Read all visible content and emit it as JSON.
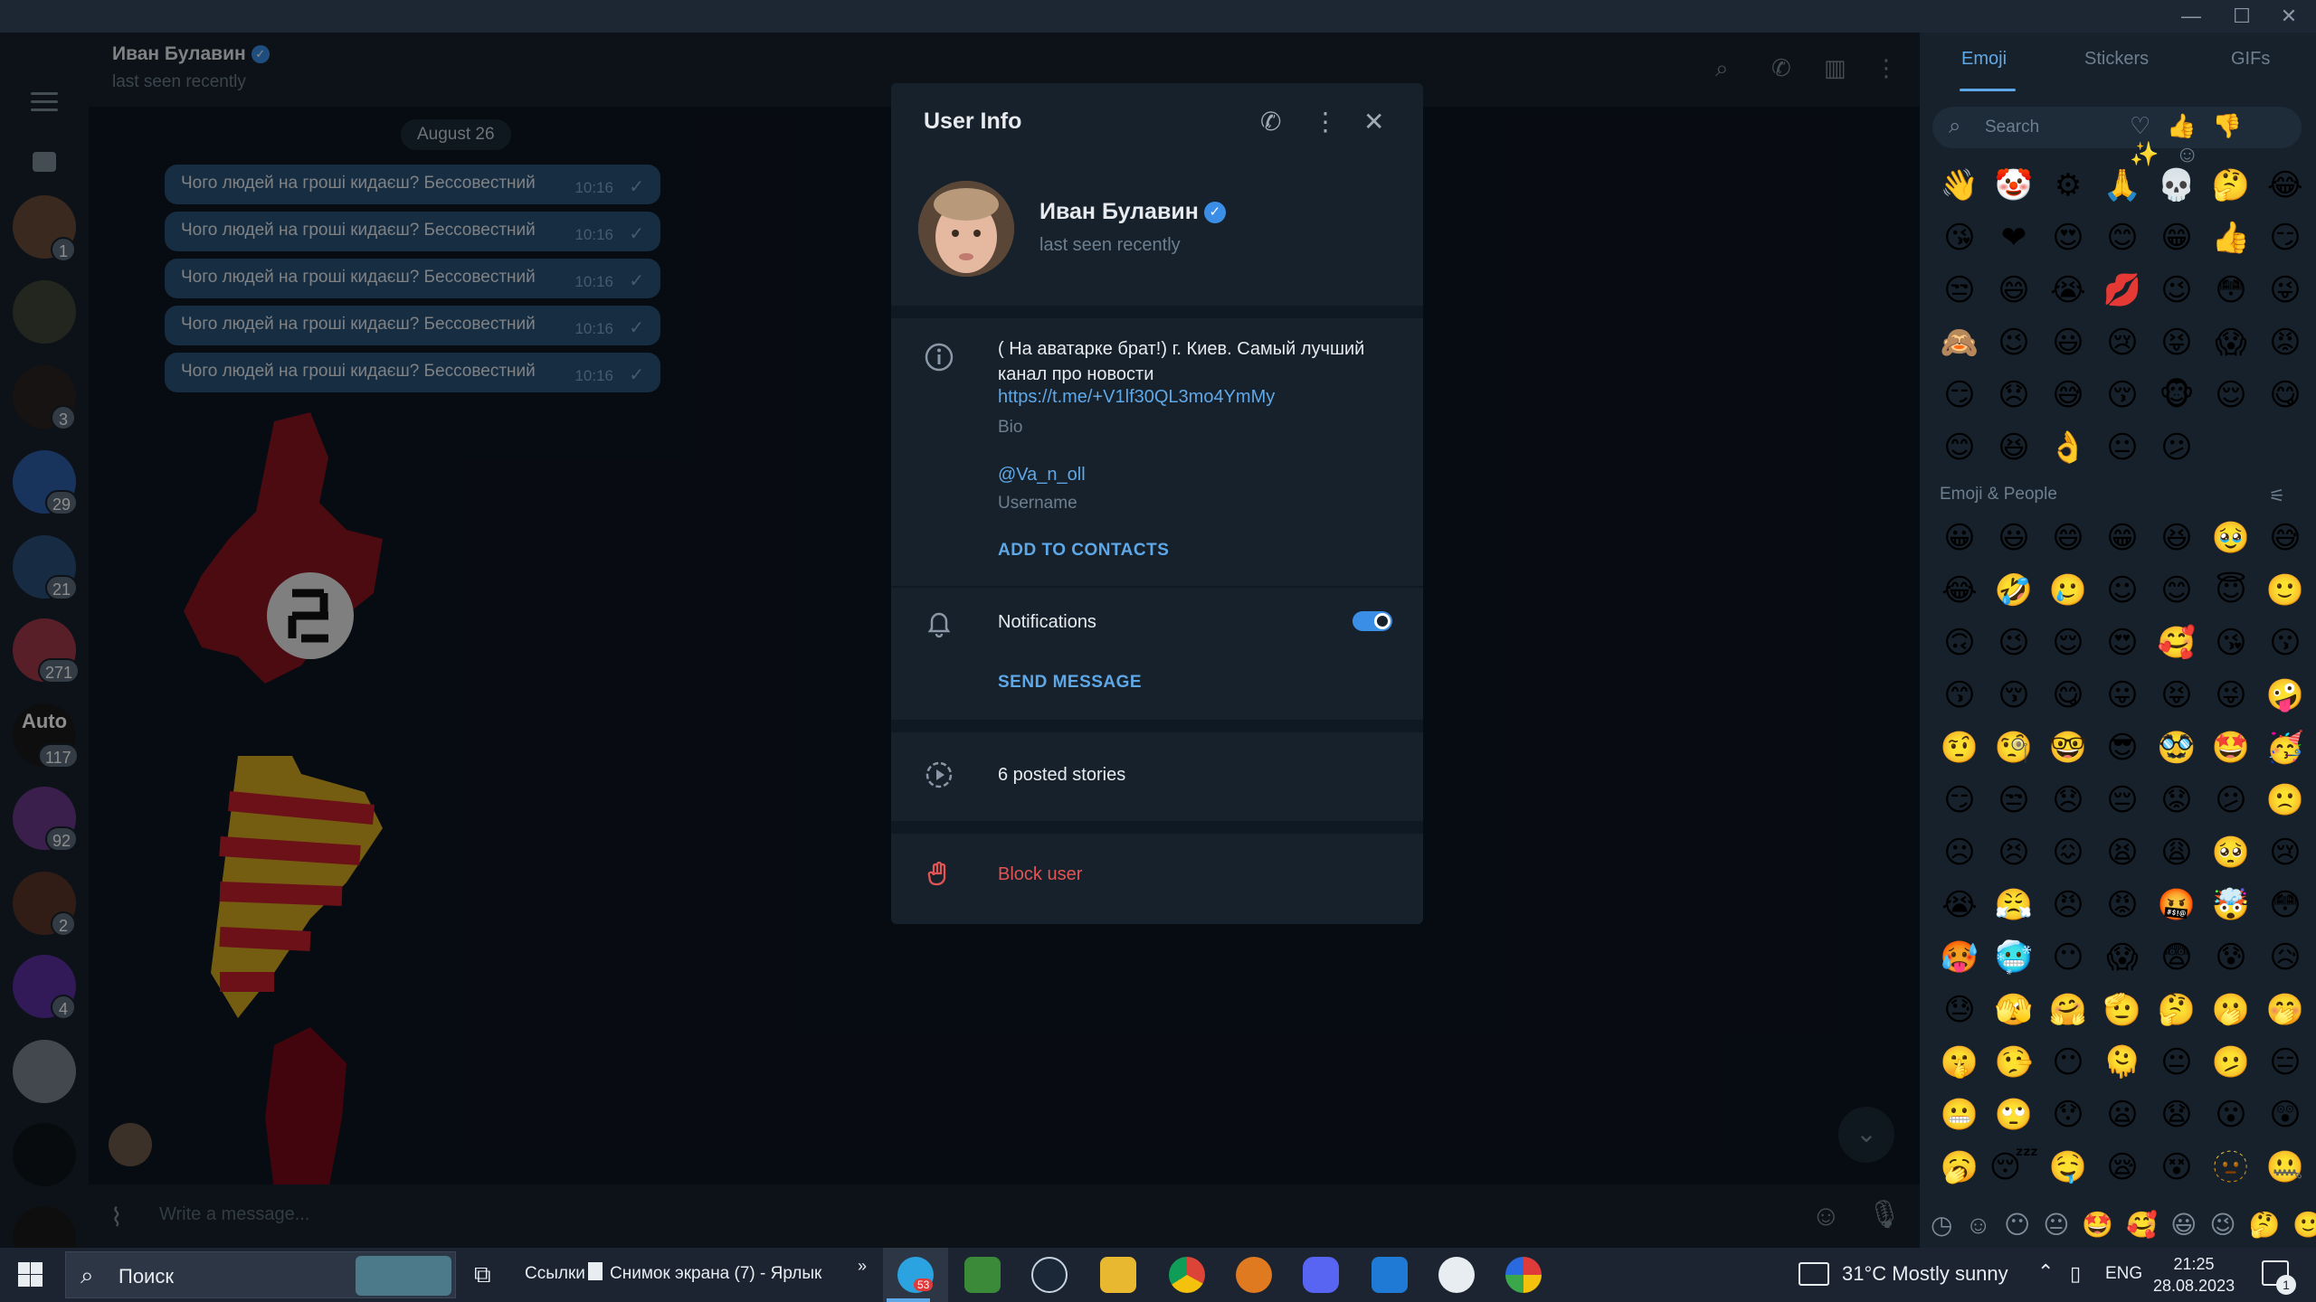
{
  "window": {
    "minimize": "—",
    "maximize": "☐",
    "close": "✕"
  },
  "sidebar": {
    "badges": [
      "1",
      "3",
      "29",
      "21",
      "271",
      "117",
      "92",
      "2",
      "4"
    ],
    "autohub_label": "Auto"
  },
  "chat": {
    "title": "Иван Булавин",
    "status": "last seen recently",
    "date": "August 26",
    "messages": [
      {
        "text": "Чого людей на гроші кидаєш? Бессовестний",
        "time": "10:16"
      },
      {
        "text": "Чого людей на гроші кидаєш? Бессовестний",
        "time": "10:16"
      },
      {
        "text": "Чого людей на гроші кидаєш? Бессовестний",
        "time": "10:16"
      },
      {
        "text": "Чого людей на гроші кидаєш? Бессовестний",
        "time": "10:16"
      },
      {
        "text": "Чого людей на гроші кидаєш? Бессовестний",
        "time": "10:16"
      }
    ],
    "input_placeholder": "Write a message..."
  },
  "user_info": {
    "title": "User Info",
    "name": "Иван Булавин",
    "status": "last seen recently",
    "bio": "( На аватарке брат!) г. Киев. Самый лучший канал про новости",
    "bio_link": "https://t.me/+V1lf30QL3mo4YmMy",
    "bio_caption": "Bio",
    "username": "@Va_n_oll",
    "username_caption": "Username",
    "add_to_contacts": "ADD TO CONTACTS",
    "notifications_label": "Notifications",
    "notifications_on": true,
    "send_message": "SEND MESSAGE",
    "stories": "6 posted stories",
    "block": "Block user"
  },
  "emoji_panel": {
    "tabs": [
      "Emoji",
      "Stickers",
      "GIFs"
    ],
    "active_tab": "Emoji",
    "search_placeholder": "Search",
    "section_title": "Emoji & People",
    "recent": [
      "👋",
      "🤡",
      "⚙",
      "🙏",
      "💀",
      "🤔",
      "😂",
      "😘",
      "❤",
      "😍",
      "😊",
      "😁",
      "👍",
      "😏",
      "😒",
      "😄",
      "😭",
      "💋",
      "😉",
      "😳",
      "😜",
      "🙈",
      "😉",
      "😃",
      "😢",
      "😝",
      "😱",
      "😡",
      "😏",
      "😞",
      "😅",
      "😚",
      "🐵",
      "😌",
      "😋",
      "😊",
      "😆",
      "👌",
      "😐",
      "😕"
    ],
    "people": [
      "😀",
      "😃",
      "😄",
      "😁",
      "😆",
      "🥹",
      "😅",
      "😂",
      "🤣",
      "🥲",
      "☺",
      "😊",
      "😇",
      "🙂",
      "🙃",
      "😉",
      "😌",
      "😍",
      "🥰",
      "😘",
      "😗",
      "😙",
      "😚",
      "😋",
      "😛",
      "😝",
      "😜",
      "🤪",
      "🤨",
      "🧐",
      "🤓",
      "😎",
      "🥸",
      "🤩",
      "🥳",
      "😏",
      "😒",
      "😞",
      "😔",
      "😟",
      "😕",
      "🙁",
      "☹",
      "😣",
      "😖",
      "😫",
      "😩",
      "🥺",
      "😢",
      "😭",
      "😤",
      "😠",
      "😡",
      "🤬",
      "🤯",
      "😳",
      "🥵",
      "🥶",
      "😶",
      "😱",
      "😨",
      "😰",
      "😥",
      "😓",
      "🫣",
      "🤗",
      "🫡",
      "🤔",
      "🫢",
      "🤭",
      "🤫",
      "🤥",
      "😶",
      "🫠",
      "😐",
      "🫤",
      "😑",
      "😬",
      "🙄",
      "😯",
      "😦",
      "😧",
      "😮",
      "😲",
      "🥱",
      "😴",
      "🤤",
      "😪",
      "😵",
      "🫥",
      "🤐"
    ],
    "colors": {
      "accent": "#5fa8e8"
    }
  },
  "taskbar": {
    "search": "Поиск",
    "links": "Ссылки",
    "pinned_file": "Снимок экрана (7) - Ярлык",
    "telegram_badge": "53",
    "weather": "31°C  Mostly sunny",
    "lang": "ENG",
    "time": "21:25",
    "date": "28.08.2023",
    "notif_count": "1"
  }
}
